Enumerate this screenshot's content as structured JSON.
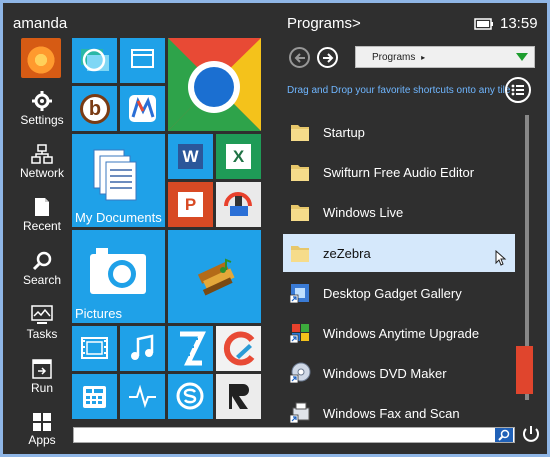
{
  "user": {
    "name": "amanda"
  },
  "nav": [
    {
      "label": "Settings",
      "icon": "gear-icon"
    },
    {
      "label": "Network",
      "icon": "network-icon"
    },
    {
      "label": "Recent",
      "icon": "recent-icon"
    },
    {
      "label": "Search",
      "icon": "search-icon"
    },
    {
      "label": "Tasks",
      "icon": "tasks-icon"
    },
    {
      "label": "Run",
      "icon": "run-icon"
    },
    {
      "label": "Apps",
      "icon": "apps-icon"
    }
  ],
  "tiles": {
    "my_documents": "My Documents",
    "pictures": "Pictures",
    "word_letter": "W",
    "excel_letter": "X",
    "powerpoint_letter": "P",
    "b_letter": "b"
  },
  "header": {
    "title": "Programs>",
    "time": "13:59"
  },
  "dropdown": {
    "value": "Programs"
  },
  "hint": "Drag and Drop your favorite shortcuts onto any tile",
  "programs": [
    {
      "label": "Startup",
      "icon": "folder-icon"
    },
    {
      "label": "Swifturn Free Audio Editor",
      "icon": "folder-icon"
    },
    {
      "label": "Windows Live",
      "icon": "folder-icon"
    },
    {
      "label": "zeZebra",
      "icon": "folder-icon",
      "selected": true
    },
    {
      "label": "Desktop Gadget Gallery",
      "icon": "shortcut-icon"
    },
    {
      "label": "Windows Anytime Upgrade",
      "icon": "windows-logo-icon"
    },
    {
      "label": "Windows DVD Maker",
      "icon": "dvd-icon"
    },
    {
      "label": "Windows Fax and Scan",
      "icon": "fax-icon"
    }
  ],
  "colors": {
    "tile_blue": "#1fa1e8",
    "accent_red": "#e0452d",
    "hint_blue": "#6fb6ff"
  }
}
